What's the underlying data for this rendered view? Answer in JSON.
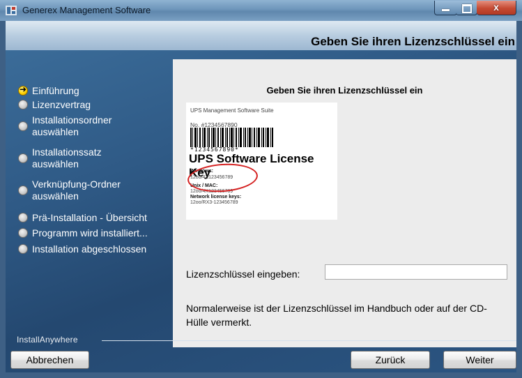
{
  "window": {
    "title": "Generex Management Software"
  },
  "header": {
    "title": "Geben Sie ihren Lizenzschlüssel ein"
  },
  "steps": [
    {
      "label": "Einführung",
      "active": true
    },
    {
      "label": "Lizenzvertrag",
      "active": false
    },
    {
      "label": "Installationsordner auswählen",
      "active": false
    },
    {
      "label": "Installationssatz auswählen",
      "active": false
    },
    {
      "label": "Verknüpfung-Ordner auswählen",
      "active": false
    },
    {
      "label": "Prä-Installation - Übersicht",
      "active": false
    },
    {
      "label": "Programm wird installiert...",
      "active": false
    },
    {
      "label": "Installation abgeschlossen",
      "active": false
    }
  ],
  "panel": {
    "heading": "Geben Sie ihren Lizenzschlüssel ein",
    "card": {
      "suite": "UPS Management Software Suite",
      "number": "No. #1234567890",
      "barcode_digits": "*1234567890*",
      "title": "UPS Software License Key",
      "windows_label": "Windows:",
      "windows_key": "12oo/4X123456789",
      "unix_label": "Unix / MAC:",
      "unix_key": "12oo/4X123456789",
      "network_label": "Network license keys:",
      "network_key": "12oo/RX3-123456789"
    },
    "input_label": "Lizenzschlüssel eingeben:",
    "input_value": "",
    "note": "Normalerweise ist der Lizenzschlüssel im Handbuch oder auf der CD-Hülle vermerkt."
  },
  "footer": {
    "brand": "InstallAnywhere",
    "cancel": "Abbrechen",
    "back": "Zurück",
    "next": "Weiter"
  }
}
